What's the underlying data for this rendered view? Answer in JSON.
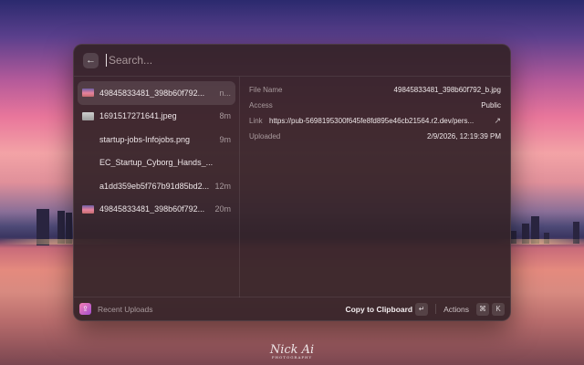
{
  "search": {
    "placeholder": "Search..."
  },
  "files": [
    {
      "name": "49845833481_398b60f792...",
      "time": "n...",
      "thumb": "sunset",
      "selected": true
    },
    {
      "name": "1691517271641.jpeg",
      "time": "8m",
      "thumb": "gray"
    },
    {
      "name": "startup-jobs-Infojobs.png",
      "time": "9m",
      "thumb": "blank"
    },
    {
      "name": "EC_Startup_Cyborg_Hands_...",
      "time": "",
      "thumb": "blank"
    },
    {
      "name": "a1dd359eb5f767b91d85bd2...",
      "time": "12m",
      "thumb": "blank"
    },
    {
      "name": "49845833481_398b60f792...",
      "time": "20m",
      "thumb": "sunset"
    }
  ],
  "detail": {
    "file_name_label": "File Name",
    "file_name_value": "49845833481_398b60f792_b.jpg",
    "access_label": "Access",
    "access_value": "Public",
    "link_label": "Link",
    "link_value": "https://pub-5698195300f645fe8fd895e46cb21564.r2.dev/pers...",
    "uploaded_label": "Uploaded",
    "uploaded_value": "2/9/2026, 12:19:39 PM"
  },
  "footer": {
    "title": "Recent Uploads",
    "primary_action": "Copy to Clipboard",
    "primary_key": "↵",
    "actions_label": "Actions",
    "actions_key_mod": "⌘",
    "actions_key": "K"
  },
  "signature": {
    "text": "Nick Ai",
    "sub": "PHOTOGRAPHY"
  },
  "colors": {
    "window_bg": "#342228",
    "accent": "#f37fb4"
  }
}
